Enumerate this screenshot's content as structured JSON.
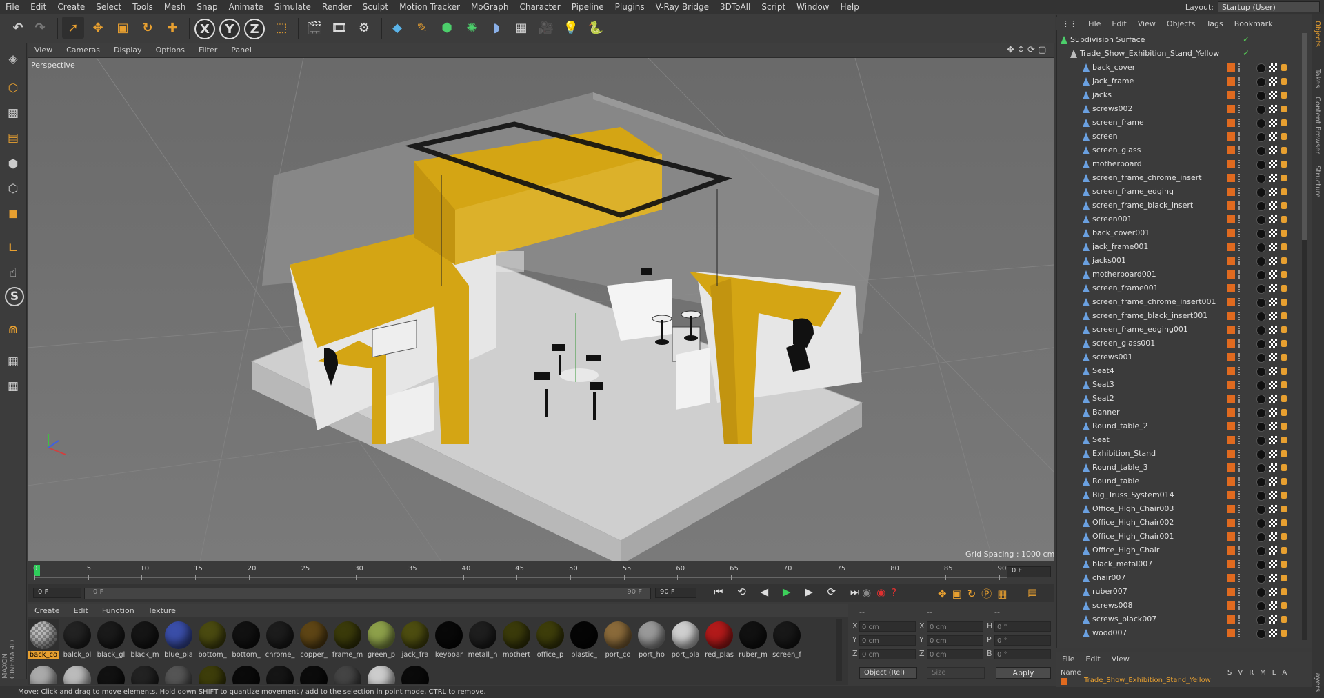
{
  "menu": [
    "File",
    "Edit",
    "Create",
    "Select",
    "Tools",
    "Mesh",
    "Snap",
    "Animate",
    "Simulate",
    "Render",
    "Sculpt",
    "Motion Tracker",
    "MoGraph",
    "Character",
    "Pipeline",
    "Plugins",
    "V-Ray Bridge",
    "3DToAll",
    "Script",
    "Window",
    "Help"
  ],
  "layout": {
    "label": "Layout:",
    "value": "Startup (User)"
  },
  "toolbar": {
    "axis_x": "X",
    "axis_y": "Y",
    "axis_z": "Z"
  },
  "left_tools": {
    "snap_s": "S"
  },
  "viewport": {
    "menu": [
      "View",
      "Cameras",
      "Display",
      "Options",
      "Filter",
      "Panel"
    ],
    "label": "Perspective",
    "grid_spacing": "Grid Spacing : 1000 cm"
  },
  "timeline": {
    "ticks": [
      "0",
      "5",
      "10",
      "15",
      "20",
      "25",
      "30",
      "35",
      "40",
      "45",
      "50",
      "55",
      "60",
      "65",
      "70",
      "75",
      "80",
      "85",
      "90"
    ],
    "current_frame": "0 F",
    "start": "0 F",
    "range_start": "0 F",
    "range_end": "90 F",
    "end": "90 F"
  },
  "materials": {
    "menu": [
      "Create",
      "Edit",
      "Function",
      "Texture"
    ],
    "items": [
      {
        "label": "back_co",
        "color": "#aaaaaa"
      },
      {
        "label": "balck_pl",
        "color": "#222222"
      },
      {
        "label": "black_gl",
        "color": "#1a1a1a"
      },
      {
        "label": "black_m",
        "color": "#151515"
      },
      {
        "label": "blue_pla",
        "color": "#3a4ea8"
      },
      {
        "label": "bottom_",
        "color": "#4a4a10"
      },
      {
        "label": "bottom_",
        "color": "#111111"
      },
      {
        "label": "chrome_",
        "color": "#1c1c1c"
      },
      {
        "label": "copper_",
        "color": "#5e4515"
      },
      {
        "label": "frame_m",
        "color": "#3a3a0a"
      },
      {
        "label": "green_p",
        "color": "#8da04a"
      },
      {
        "label": "jack_fra",
        "color": "#4d4d10"
      },
      {
        "label": "keyboar",
        "color": "#080808"
      },
      {
        "label": "metall_n",
        "color": "#1e1e1e"
      },
      {
        "label": "mothert",
        "color": "#3a3a0a"
      },
      {
        "label": "office_p",
        "color": "#3d3d0a"
      },
      {
        "label": "plastic_",
        "color": "#050505"
      },
      {
        "label": "port_co",
        "color": "#8a6a3a"
      },
      {
        "label": "port_ho",
        "color": "#999999"
      },
      {
        "label": "port_pla",
        "color": "#cfcfcf"
      },
      {
        "label": "red_plas",
        "color": "#b21a1a"
      },
      {
        "label": "ruber_m",
        "color": "#111111"
      },
      {
        "label": "screen_f",
        "color": "#181818"
      }
    ],
    "row2_colors": [
      "#aaaaaa",
      "#bbbbbb",
      "#111111",
      "#222222",
      "#555555",
      "#3d3d0a",
      "#0a0a0a",
      "#151515",
      "#0b0b0b",
      "#444444",
      "#cccccc",
      "#0a0a0a"
    ]
  },
  "coords": {
    "headers": [
      "--",
      "--",
      "--"
    ],
    "rows": [
      {
        "a": "X",
        "av": "0 cm",
        "b": "X",
        "bv": "0 cm",
        "c": "H",
        "cv": "0 °"
      },
      {
        "a": "Y",
        "av": "0 cm",
        "b": "Y",
        "bv": "0 cm",
        "c": "P",
        "cv": "0 °"
      },
      {
        "a": "Z",
        "av": "0 cm",
        "b": "Z",
        "bv": "0 cm",
        "c": "B",
        "cv": "0 °"
      }
    ],
    "mode": "Object (Rel)",
    "size": "Size",
    "apply": "Apply"
  },
  "status": "Move: Click and drag to move elements. Hold down SHIFT to quantize movement / add to the selection in point mode, CTRL to remove.",
  "objects": {
    "menu": [
      "File",
      "Edit",
      "View",
      "Objects",
      "Tags",
      "Bookmark"
    ],
    "root": "Subdivision Surface",
    "group": "Trade_Show_Exhibition_Stand_Yellow",
    "items": [
      "back_cover",
      "jack_frame",
      "jacks",
      "screws002",
      "screen_frame",
      "screen",
      "screen_glass",
      "motherboard",
      "screen_frame_chrome_insert",
      "screen_frame_edging",
      "screen_frame_black_insert",
      "screen001",
      "back_cover001",
      "jack_frame001",
      "jacks001",
      "motherboard001",
      "screen_frame001",
      "screen_frame_chrome_insert001",
      "screen_frame_black_insert001",
      "screen_frame_edging001",
      "screen_glass001",
      "screws001",
      "Seat4",
      "Seat3",
      "Seat2",
      "Banner",
      "Round_table_2",
      "Seat",
      "Exhibition_Stand",
      "Round_table_3",
      "Round_table",
      "Big_Truss_System014",
      "Office_High_Chair003",
      "Office_High_Chair002",
      "Office_High_Chair001",
      "Office_High_Chair",
      "black_metal007",
      "chair007",
      "ruber007",
      "screws008",
      "screws_black007",
      "wood007"
    ]
  },
  "layers": {
    "menu": [
      "File",
      "Edit",
      "View"
    ],
    "name_header": "Name",
    "cols": [
      "S",
      "V",
      "R",
      "M",
      "L",
      "A"
    ],
    "row": "Trade_Show_Exhibition_Stand_Yellow"
  },
  "right_tabs": [
    "Objects",
    "Takes",
    "Content Browser",
    "Structure",
    "Layers"
  ]
}
